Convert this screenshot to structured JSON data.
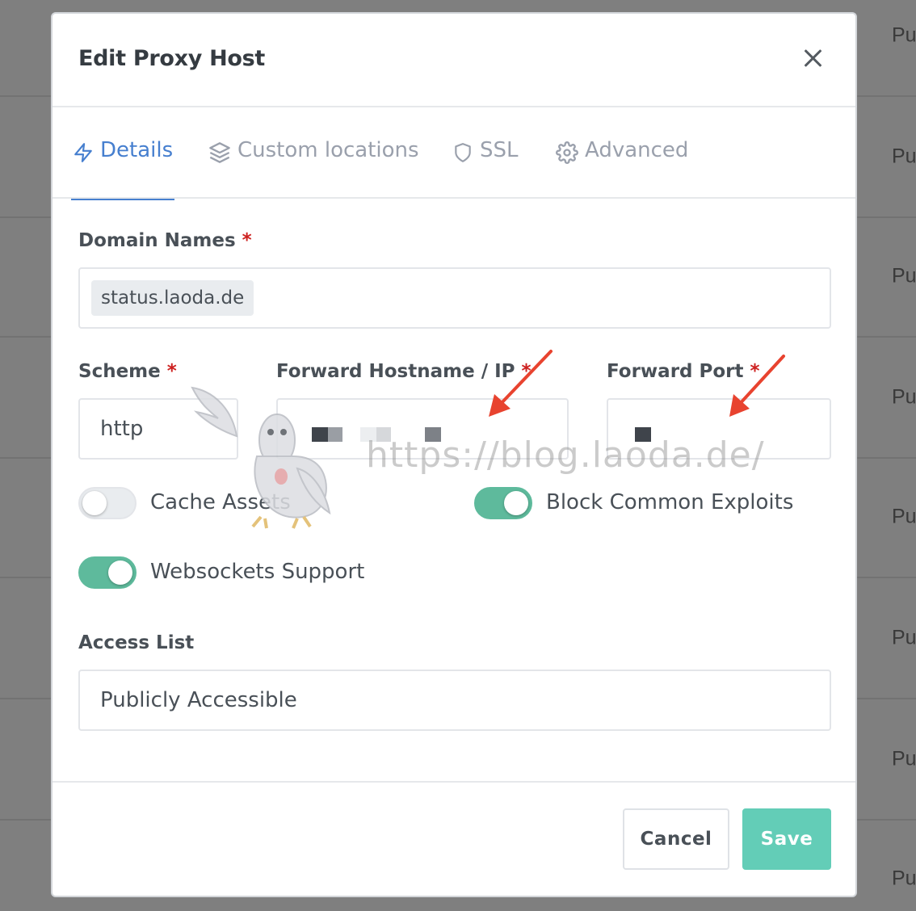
{
  "background": {
    "rows": [
      "Pu",
      "Pu",
      "Pu",
      "Pu",
      "Pu",
      "Pu",
      "Pu",
      "Pu"
    ]
  },
  "modal": {
    "title": "Edit Proxy Host",
    "close_icon": "close-icon"
  },
  "tabs": [
    {
      "label": "Details",
      "icon": "bolt-icon",
      "active": true
    },
    {
      "label": "Custom locations",
      "icon": "layers-icon",
      "active": false
    },
    {
      "label": "SSL",
      "icon": "shield-icon",
      "active": false
    },
    {
      "label": "Advanced",
      "icon": "gear-icon",
      "active": false
    }
  ],
  "form": {
    "domain_names": {
      "label": "Domain Names",
      "required_mark": "*",
      "values": [
        "status.laoda.de"
      ]
    },
    "scheme": {
      "label": "Scheme",
      "required_mark": "*",
      "value": "http"
    },
    "forward_hostname": {
      "label": "Forward Hostname / IP",
      "required_mark": "*"
    },
    "forward_port": {
      "label": "Forward Port",
      "required_mark": "*"
    },
    "toggles": {
      "cache_assets": {
        "label": "Cache Assets",
        "on": false
      },
      "block_exploits": {
        "label": "Block Common Exploits",
        "on": true
      },
      "websockets": {
        "label": "Websockets Support",
        "on": true
      }
    },
    "access_list": {
      "label": "Access List",
      "value": "Publicly Accessible"
    }
  },
  "footer": {
    "cancel_label": "Cancel",
    "save_label": "Save"
  },
  "watermark": {
    "text": "https://blog.laoda.de/"
  },
  "colors": {
    "accent": "#467fcf",
    "toggle_on": "#5eba9c",
    "save_button": "#63cdb7",
    "required": "#cd201f",
    "annotation_arrow": "#e8432f"
  }
}
